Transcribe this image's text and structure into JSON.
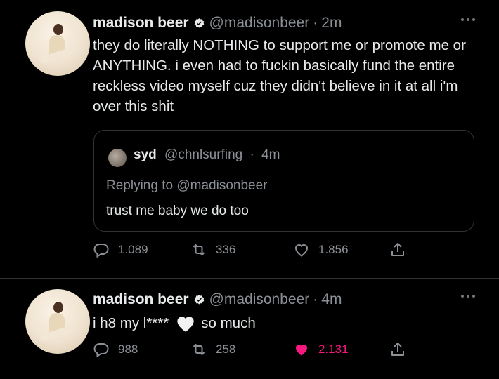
{
  "tweets": [
    {
      "author_name": "madison beer",
      "handle": "@madisonbeer",
      "time": "2m",
      "text": "they do literally NOTHING to support me or promote me or ANYTHING. i even had to fuckin basically fund the entire reckless video myself cuz they didn't believe in it at all i'm over this shit",
      "quoted": {
        "author_name": "syd",
        "handle": "@chnlsurfing",
        "time": "4m",
        "replying_label": "Replying to",
        "replying_handle": "@madisonbeer",
        "text": "trust me baby we do too"
      },
      "stats": {
        "replies": "1.089",
        "retweets": "336",
        "likes": "1.856"
      },
      "liked": false
    },
    {
      "author_name": "madison beer",
      "handle": "@madisonbeer",
      "time": "4m",
      "text_before": "i h8 my l****",
      "emoji": "white-heart",
      "text_after": "so much",
      "stats": {
        "replies": "988",
        "retweets": "258",
        "likes": "2.131"
      },
      "liked": true
    }
  ],
  "colors": {
    "background": "#000000",
    "text": "#e7e9ea",
    "secondary": "#8b9096",
    "verified": "#e7e9ea",
    "like": "#f91880",
    "border": "#2f3336"
  },
  "icons": [
    "verified-badge-icon",
    "more-icon",
    "reply-icon",
    "retweet-icon",
    "like-icon",
    "share-icon"
  ]
}
